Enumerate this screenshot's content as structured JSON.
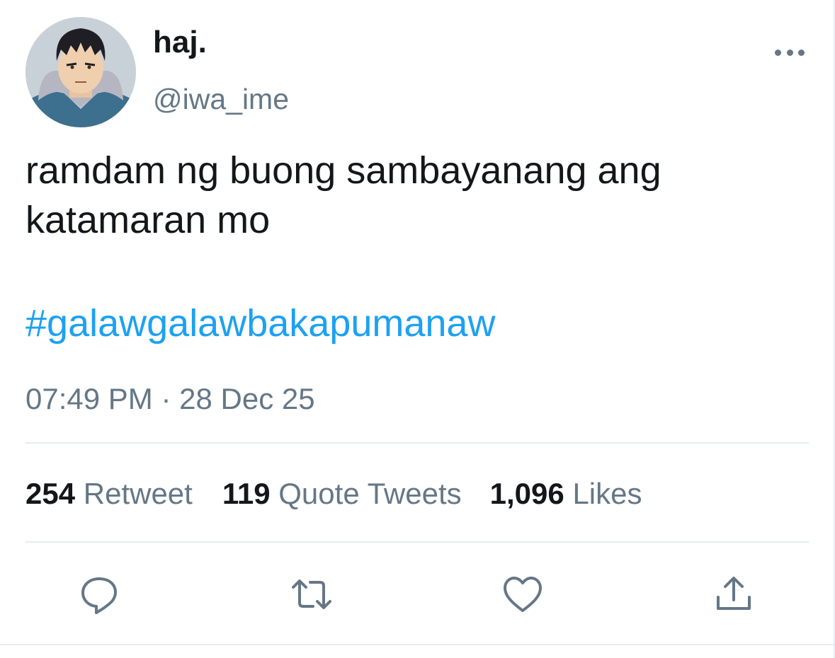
{
  "tweet": {
    "author": {
      "display_name": "haj.",
      "handle": "@iwa_ime",
      "avatar_icon": "anime-character-avatar"
    },
    "more_icon": "more-horizontal-icon",
    "text_line1": "ramdam ng buong sambayanang ang",
    "text_line2": "katamaran mo",
    "hashtag": "#galawgalawbakapumanaw",
    "time": "07:49 PM",
    "separator": "·",
    "date": "28 Dec 25"
  },
  "stats": {
    "retweets": {
      "count": "254",
      "label": "Retweet"
    },
    "quotes": {
      "count": "119",
      "label": "Quote Tweets"
    },
    "likes": {
      "count": "1,096",
      "label": "Likes"
    }
  },
  "actions": {
    "reply_icon": "comment-icon",
    "retweet_icon": "retweet-icon",
    "like_icon": "heart-icon",
    "share_icon": "share-icon"
  },
  "colors": {
    "text": "#14171a",
    "secondary": "#657786",
    "link": "#1da1f2",
    "divider": "#e6ecf0"
  }
}
